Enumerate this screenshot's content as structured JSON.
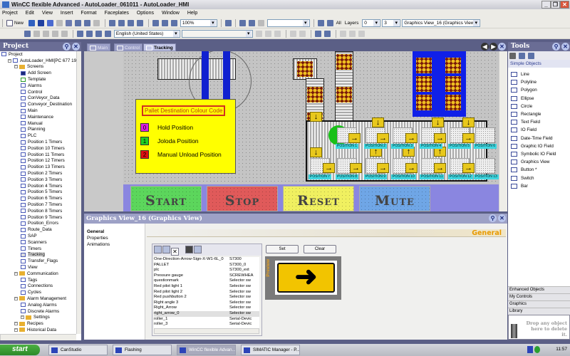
{
  "window": {
    "title": "WinCC flexible Advanced - AutoLoader_061011 - AutoLoader_HMI"
  },
  "menu": [
    "Project",
    "Edit",
    "View",
    "Insert",
    "Format",
    "Faceplates",
    "Options",
    "Window",
    "Help"
  ],
  "toolbar": {
    "new_label": "New",
    "zoom": "100%",
    "language": "English (United States)",
    "all_label": "All",
    "layers_label": "Layers",
    "layer_from": "0",
    "layer_to": "3",
    "object_select": "Graphics View_16 (Graphics View)"
  },
  "project": {
    "title": "Project",
    "tree": [
      {
        "label": "Project",
        "level": 0,
        "type": "root"
      },
      {
        "label": "AutoLoader_HMI[PC 677 19\" 1",
        "level": 1,
        "type": "device"
      },
      {
        "label": "Screens",
        "level": 2,
        "type": "folder"
      },
      {
        "label": "Add Screen",
        "level": 3,
        "type": "add"
      },
      {
        "label": "Template",
        "level": 3,
        "type": "screen"
      },
      {
        "label": "Alarms",
        "level": 3,
        "type": "screen"
      },
      {
        "label": "Control",
        "level": 3,
        "type": "screen"
      },
      {
        "label": "ConVeyor_Data",
        "level": 3,
        "type": "screen"
      },
      {
        "label": "Conveyor_Destination",
        "level": 3,
        "type": "screen"
      },
      {
        "label": "Main",
        "level": 3,
        "type": "screen"
      },
      {
        "label": "Maintenance",
        "level": 3,
        "type": "screen"
      },
      {
        "label": "Manual",
        "level": 3,
        "type": "screen"
      },
      {
        "label": "Planning",
        "level": 3,
        "type": "screen"
      },
      {
        "label": "PLC",
        "level": 3,
        "type": "screen"
      },
      {
        "label": "Position 1 Timers",
        "level": 3,
        "type": "screen"
      },
      {
        "label": "Position 10 Timers",
        "level": 3,
        "type": "screen"
      },
      {
        "label": "Position 11 Timers",
        "level": 3,
        "type": "screen"
      },
      {
        "label": "Position 12 Timers",
        "level": 3,
        "type": "screen"
      },
      {
        "label": "Position 13 Timers",
        "level": 3,
        "type": "screen"
      },
      {
        "label": "Position 2 Timers",
        "level": 3,
        "type": "screen"
      },
      {
        "label": "Position 3 Timers",
        "level": 3,
        "type": "screen"
      },
      {
        "label": "Position 4 Timers",
        "level": 3,
        "type": "screen"
      },
      {
        "label": "Position 5 Timers",
        "level": 3,
        "type": "screen"
      },
      {
        "label": "Position 6 Timers",
        "level": 3,
        "type": "screen"
      },
      {
        "label": "Position 7 Timers",
        "level": 3,
        "type": "screen"
      },
      {
        "label": "Position 8 Timers",
        "level": 3,
        "type": "screen"
      },
      {
        "label": "Position 9 Timers",
        "level": 3,
        "type": "screen"
      },
      {
        "label": "Position_Errors",
        "level": 3,
        "type": "screen"
      },
      {
        "label": "Route_Data",
        "level": 3,
        "type": "screen"
      },
      {
        "label": "SAP",
        "level": 3,
        "type": "screen"
      },
      {
        "label": "Scanners",
        "level": 3,
        "type": "screen"
      },
      {
        "label": "Timers",
        "level": 3,
        "type": "screen"
      },
      {
        "label": "Tracking",
        "level": 3,
        "type": "screen",
        "selected": true
      },
      {
        "label": "Transfer_Flags",
        "level": 3,
        "type": "screen"
      },
      {
        "label": "View",
        "level": 3,
        "type": "screen"
      },
      {
        "label": "Communication",
        "level": 2,
        "type": "folder"
      },
      {
        "label": "Tags",
        "level": 3,
        "type": "item"
      },
      {
        "label": "Connections",
        "level": 3,
        "type": "item"
      },
      {
        "label": "Cycles",
        "level": 3,
        "type": "item"
      },
      {
        "label": "Alarm Management",
        "level": 2,
        "type": "folder"
      },
      {
        "label": "Analog Alarms",
        "level": 3,
        "type": "item"
      },
      {
        "label": "Discrete Alarms",
        "level": 3,
        "type": "item"
      },
      {
        "label": "Settings",
        "level": 3,
        "type": "folder"
      },
      {
        "label": "Recipes",
        "level": 2,
        "type": "folder"
      },
      {
        "label": "Historical Data",
        "level": 2,
        "type": "folder"
      }
    ]
  },
  "editor": {
    "tabs": [
      "Main",
      "Control",
      "Tracking"
    ],
    "active_tab": "Tracking"
  },
  "hmi": {
    "legend": {
      "title": "Pallet Destination Colour Code",
      "items": [
        {
          "num": "0",
          "label": "Hold Position",
          "color": "#e020e0"
        },
        {
          "num": "1",
          "label": "Joloda Position",
          "color": "#20d020"
        },
        {
          "num": "2",
          "label": "Manual Unload Position",
          "color": "#e01010"
        }
      ]
    },
    "buttons": [
      {
        "label": "Start",
        "color": "#5cd65c"
      },
      {
        "label": "Stop",
        "color": "#e05a5a"
      },
      {
        "label": "Reset",
        "color": "#f0f060"
      },
      {
        "label": "Mute",
        "color": "#6fa6e6"
      }
    ],
    "positions": [
      "POSITION 1",
      "POSITION 2",
      "POSITION 3",
      "POSITION 4",
      "POSITION 5",
      "POSITION 6",
      "POSITION 7",
      "POSITION 8",
      "POSITION 9",
      "POSITION 10",
      "POSITION 11",
      "POSITION 12",
      "POSITION 13"
    ]
  },
  "properties": {
    "title": "Graphics View_16 (Graphics View)",
    "nav": [
      "General",
      "Properties",
      "Animations"
    ],
    "section": "General",
    "set_label": "Set",
    "clear_label": "Clear",
    "preview_label": "Preview",
    "graphics": [
      [
        "One-Direction-Arrow-Sign-X-W1-6L_0",
        "S7300"
      ],
      [
        "PALLET",
        "S7300_0"
      ],
      [
        "plc",
        "S7300_ext"
      ],
      [
        "Pressure gauge",
        "SCREWHEA"
      ],
      [
        "questionmark",
        "Selector sw"
      ],
      [
        "Red pilot light 1",
        "Selector sw"
      ],
      [
        "Red pilot light 2",
        "Selector sw"
      ],
      [
        "Red pushbutton 2",
        "Selector sw"
      ],
      [
        "Right angle 3",
        "Selector sw"
      ],
      [
        "Right_Arrow",
        "Selector sw"
      ],
      [
        "right_arrow_0",
        "Selector sw"
      ],
      [
        "roller_1",
        "Serial-Devic"
      ],
      [
        "roller_3",
        "Serial-Devic"
      ]
    ]
  },
  "tools": {
    "title": "Tools",
    "section": "Simple Objects",
    "items": [
      "Line",
      "Polyline",
      "Polygon",
      "Ellipse",
      "Circle",
      "Rectangle",
      "Text Field",
      "IO Field",
      "Date-Time Field",
      "Graphic IO Field",
      "Symbolic IO Field",
      "Graphics View",
      "Button *",
      "Switch",
      "Bar"
    ],
    "categories": [
      "Enhanced Objects",
      "My Controls",
      "Graphics",
      "Library"
    ],
    "trash_text": "Drop any object here to delete it."
  },
  "taskbar": {
    "start": "start",
    "tasks": [
      "CanStudio",
      "Flashing",
      "WinCC flexible Advan...",
      "SIMATIC Manager - P..."
    ],
    "active": 2,
    "clock": "11:57"
  }
}
